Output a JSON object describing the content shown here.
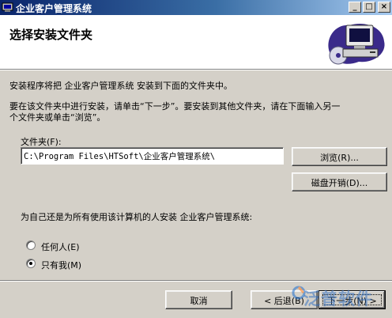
{
  "window": {
    "title": "企业客户管理系统",
    "controls": {
      "minimize": "_",
      "maximize": "□",
      "close": "×"
    }
  },
  "header": {
    "title": "选择安装文件夹",
    "art_icon": "computer-with-disc-icon"
  },
  "body": {
    "intro": "安装程序将把 企业客户管理系统 安装到下面的文件夹中。",
    "instruction_line1": "要在该文件夹中进行安装，请单击“下一步”。要安装到其他文件夹，请在下面输入另一",
    "instruction_line2": "个文件夹或单击“浏览”。",
    "folder_label": "文件夹(F):",
    "folder_value": "C:\\Program Files\\HTSoft\\企业客户管理系统\\",
    "browse_label": "浏览(R)...",
    "disk_cost_label": "磁盘开销(D)...",
    "install_for_label": "为自己还是为所有使用该计算机的人安装 企业客户管理系统:",
    "radio_options": [
      {
        "label": "任何人(E)",
        "selected": false
      },
      {
        "label": "只有我(M)",
        "selected": true
      }
    ]
  },
  "footer": {
    "cancel_label": "取消",
    "back_label": "< 后退(B)",
    "next_label": "下一步(N) >"
  },
  "watermark": {
    "text": "泛普软件"
  },
  "colors": {
    "titlebar_start": "#0a246a",
    "titlebar_end": "#a6caf0",
    "face": "#d4d0c8"
  }
}
